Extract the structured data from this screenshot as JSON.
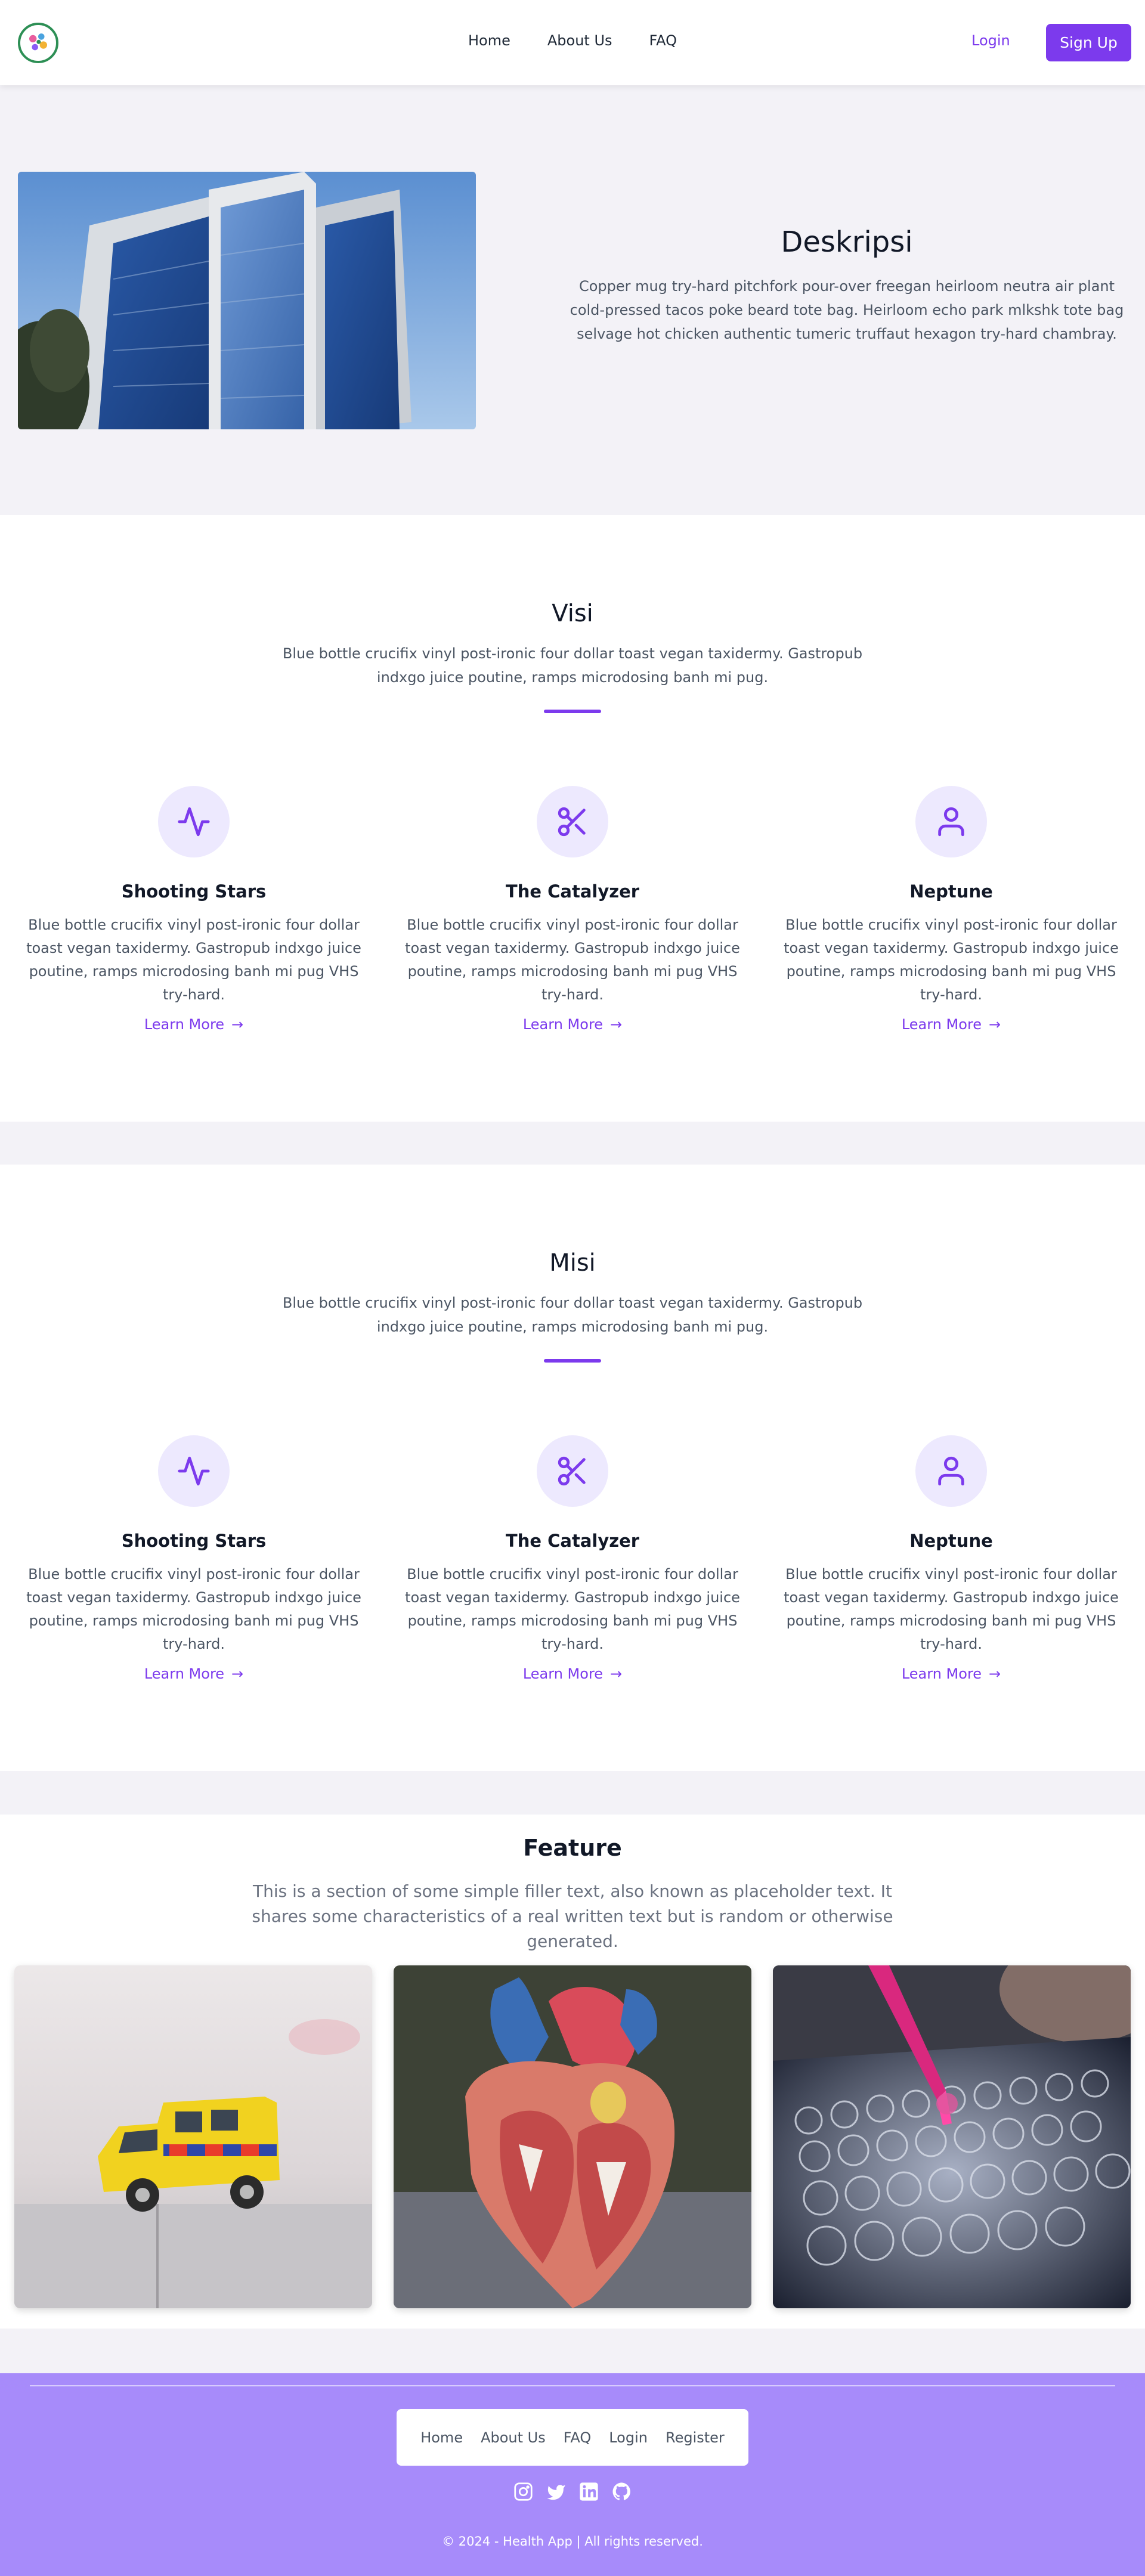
{
  "nav": {
    "logo_icon": "health-app-logo-icon",
    "links": [
      "Home",
      "About Us",
      "FAQ"
    ],
    "login": "Login",
    "signup": "Sign Up"
  },
  "deskripsi": {
    "title": "Deskripsi",
    "text": "Copper mug try-hard pitchfork pour-over freegan heirloom neutra air plant cold-pressed tacos poke beard tote bag. Heirloom echo park mlkshk tote bag selvage hot chicken authentic tumeric truffaut hexagon try-hard chambray.",
    "image_icon": "building-photo"
  },
  "visi": {
    "title": "Visi",
    "subtitle": "Blue bottle crucifix vinyl post-ironic four dollar toast vegan taxidermy. Gastropub indxgo juice poutine, ramps microdosing banh mi pug.",
    "cards": [
      {
        "icon": "activity-icon",
        "title": "Shooting Stars",
        "text": "Blue bottle crucifix vinyl post-ironic four dollar toast vegan taxidermy. Gastropub indxgo juice poutine, ramps microdosing banh mi pug VHS try-hard.",
        "link": "Learn More"
      },
      {
        "icon": "scissors-icon",
        "title": "The Catalyzer",
        "text": "Blue bottle crucifix vinyl post-ironic four dollar toast vegan taxidermy. Gastropub indxgo juice poutine, ramps microdosing banh mi pug VHS try-hard.",
        "link": "Learn More"
      },
      {
        "icon": "user-icon",
        "title": "Neptune",
        "text": "Blue bottle crucifix vinyl post-ironic four dollar toast vegan taxidermy. Gastropub indxgo juice poutine, ramps microdosing banh mi pug VHS try-hard.",
        "link": "Learn More"
      }
    ]
  },
  "misi": {
    "title": "Misi",
    "subtitle": "Blue bottle crucifix vinyl post-ironic four dollar toast vegan taxidermy. Gastropub indxgo juice poutine, ramps microdosing banh mi pug.",
    "cards": [
      {
        "icon": "activity-icon",
        "title": "Shooting Stars",
        "text": "Blue bottle crucifix vinyl post-ironic four dollar toast vegan taxidermy. Gastropub indxgo juice poutine, ramps microdosing banh mi pug VHS try-hard.",
        "link": "Learn More"
      },
      {
        "icon": "scissors-icon",
        "title": "The Catalyzer",
        "text": "Blue bottle crucifix vinyl post-ironic four dollar toast vegan taxidermy. Gastropub indxgo juice poutine, ramps microdosing banh mi pug VHS try-hard.",
        "link": "Learn More"
      },
      {
        "icon": "user-icon",
        "title": "Neptune",
        "text": "Blue bottle crucifix vinyl post-ironic four dollar toast vegan taxidermy. Gastropub indxgo juice poutine, ramps microdosing banh mi pug VHS try-hard.",
        "link": "Learn More"
      }
    ]
  },
  "feature": {
    "title": "Feature",
    "subtitle": "This is a section of some simple filler text, also known as placeholder text. It shares some characteristics of a real written text but is random or otherwise generated.",
    "images": [
      "toy-ambulance-photo",
      "anatomical-heart-model-photo",
      "test-tubes-pipette-photo"
    ]
  },
  "footer": {
    "links": [
      "Home",
      "About Us",
      "FAQ",
      "Login",
      "Register"
    ],
    "social_icons": [
      "instagram-icon",
      "twitter-icon",
      "linkedin-icon",
      "github-icon"
    ],
    "copyright": "© 2024 - Health App | All rights reserved."
  },
  "colors": {
    "accent": "#7c3aed",
    "accent_light": "#ede9fe",
    "footer_bg": "#a78bfa",
    "page_bg": "#f3f2f7"
  }
}
